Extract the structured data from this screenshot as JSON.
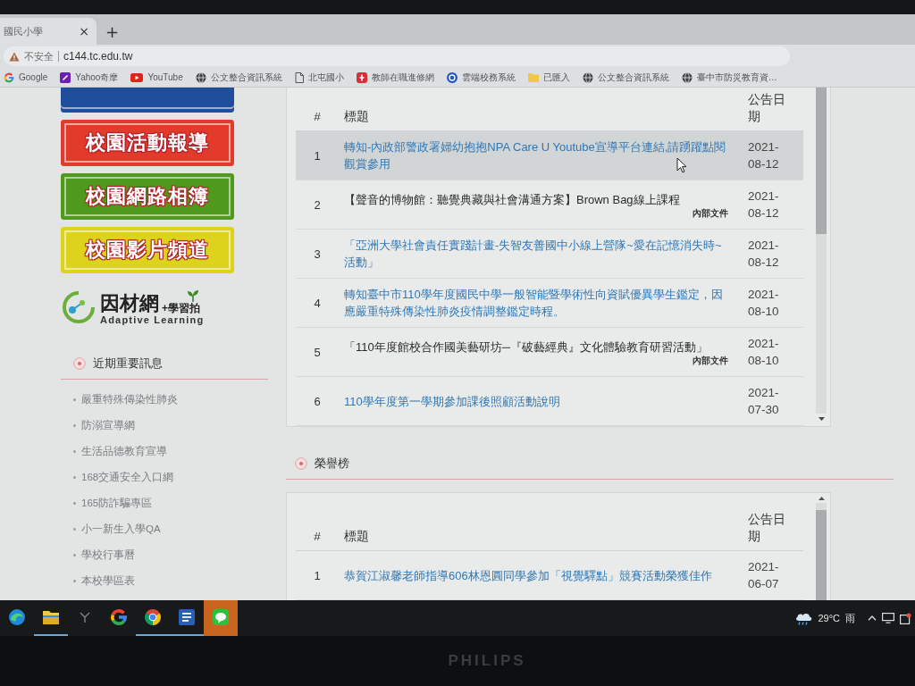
{
  "browser": {
    "tab": {
      "title": "國民小學",
      "close": "×"
    },
    "new_tab": "+",
    "address": {
      "security": "不安全",
      "url": "c144.tc.edu.tw"
    },
    "bookmarks": [
      {
        "label": "Google",
        "kind": "google"
      },
      {
        "label": "Yahoo奇摩",
        "kind": "yahoo"
      },
      {
        "label": "YouTube",
        "kind": "youtube"
      },
      {
        "label": "公文整合資訊系統",
        "kind": "globe"
      },
      {
        "label": "北屯國小",
        "kind": "page"
      },
      {
        "label": "教師在職進修網",
        "kind": "red-app"
      },
      {
        "label": "雲端校務系統",
        "kind": "blue-app"
      },
      {
        "label": "已匯入",
        "kind": "folder"
      },
      {
        "label": "公文整合資訊系統",
        "kind": "globe"
      },
      {
        "label": "臺中市防災教育資…",
        "kind": "globe"
      }
    ]
  },
  "sidebar": {
    "banners": [
      {
        "color": "#1f4f9a"
      },
      {
        "label": "校園活動報導",
        "color": "#e23b2b"
      },
      {
        "label": "校園網路相簿",
        "color": "#4f9a1c"
      },
      {
        "label": "校園影片頻道",
        "color": "#ddd21c"
      }
    ],
    "logo": {
      "name": "因材網",
      "tagline": "+學習拍",
      "subtitle": "Adaptive Learning"
    },
    "news": {
      "title": "近期重要訊息",
      "items": [
        "嚴重特殊傳染性肺炎",
        "防溺宣導網",
        "生活品德教育宣導",
        "168交通安全入口網",
        "165防詐騙專區",
        "小一新生入學QA",
        "學校行事曆",
        "本校學區表"
      ]
    }
  },
  "announcements": {
    "columns": [
      "#",
      "標題",
      "公告日期"
    ],
    "rows": [
      {
        "number": "1",
        "title": "轉知-內政部警政署婦幼抱抱NPA Care U Youtube宣導平台連結,請踴躍點閱觀賞參用",
        "date": "2021-08-12",
        "kind": "link",
        "highlighted": true
      },
      {
        "number": "2",
        "title": "【聲音的博物館：聽覺典藏與社會溝通方案】Brown Bag線上課程",
        "tag": "內部文件",
        "date": "2021-08-12",
        "kind": "internal",
        "highlighted": false
      },
      {
        "number": "3",
        "title": "「亞洲大學社會責任實踐計畫-失智友善國中小線上營隊~愛在記憶消失時~活動」",
        "date": "2021-08-12",
        "kind": "link",
        "highlighted": false
      },
      {
        "number": "4",
        "title": "轉知臺中市110學年度國民中學一般智能暨學術性向資賦優異學生鑑定，因應嚴重特殊傳染性肺炎疫情調整鑑定時程。",
        "date": "2021-08-10",
        "kind": "link",
        "highlighted": false
      },
      {
        "number": "5",
        "title": "「110年度館校合作國美藝研坊─『破藝經典』文化體驗教育研習活動」",
        "tag": "內部文件",
        "date": "2021-08-10",
        "kind": "internal",
        "highlighted": false
      },
      {
        "number": "6",
        "title": "110學年度第一學期參加課後照顧活動說明",
        "date": "2021-07-30",
        "kind": "link",
        "highlighted": false
      }
    ]
  },
  "honor_roll": {
    "title": "榮譽榜",
    "columns": [
      "#",
      "標題",
      "公告日期"
    ],
    "rows": [
      {
        "number": "1",
        "title": "恭賀江淑馨老師指導606林恩圓同學參加「視覺驛點」競賽活動榮獲佳作",
        "date": "2021-06-07",
        "kind": "link"
      }
    ]
  },
  "taskbar": {
    "apps": [
      {
        "kind": "edge",
        "running": false,
        "flashing": false
      },
      {
        "kind": "explorer",
        "running": true,
        "flashing": false
      },
      {
        "kind": "fork",
        "running": false,
        "flashing": false
      },
      {
        "kind": "google",
        "running": false,
        "flashing": false
      },
      {
        "kind": "chrome",
        "running": true,
        "flashing": false
      },
      {
        "kind": "word",
        "running": true,
        "flashing": false
      },
      {
        "kind": "line",
        "running": false,
        "flashing": true
      }
    ],
    "weather": {
      "temperature": "29°C",
      "condition": "雨"
    }
  },
  "monitor": {
    "brand": "PHILIPS"
  }
}
